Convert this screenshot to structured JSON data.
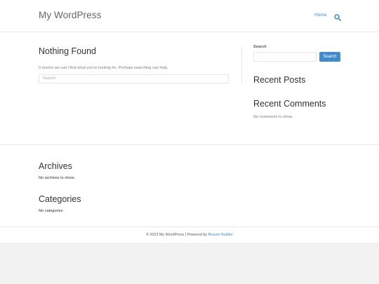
{
  "header": {
    "site_title": "My WordPress",
    "nav": [
      {
        "label": "Home"
      }
    ],
    "search_icon": "search-icon"
  },
  "main": {
    "title": "Nothing Found",
    "message": "It seems we can't find what you're looking for. Perhaps searching can help.",
    "search_placeholder": "Search"
  },
  "sidebar": {
    "search_label": "Search",
    "search_button": "Search",
    "search_value": "",
    "recent_posts_title": "Recent Posts",
    "recent_comments_title": "Recent Comments",
    "no_comments": "No comments to show."
  },
  "footer_widgets": {
    "archives_title": "Archives",
    "archives_text": "No archives to show.",
    "categories_title": "Categories",
    "categories_text": "No categories"
  },
  "footer": {
    "copyright": "© 2023 My WordPress | Powered by",
    "powered_link": "Beaver Builder"
  },
  "colors": {
    "accent": "#428bca",
    "text": "#333333",
    "muted": "#808080",
    "border": "#e6e6e6",
    "page_bg": "#f2f2f2"
  }
}
